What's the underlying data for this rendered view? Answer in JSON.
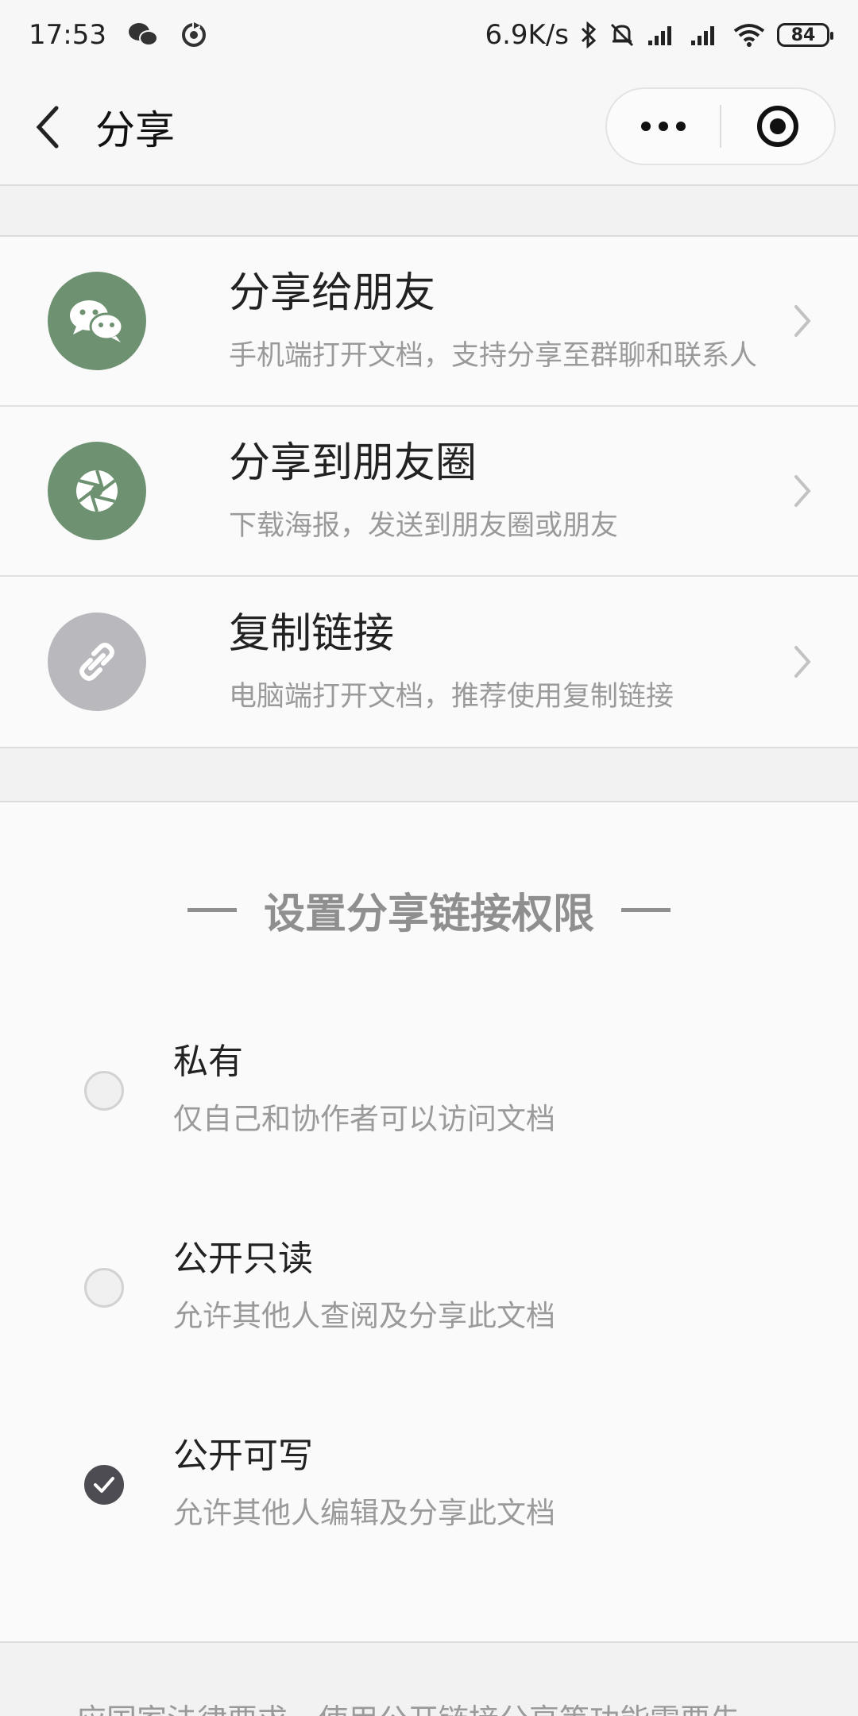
{
  "status_bar": {
    "time": "17:53",
    "net_speed": "6.9K/s",
    "battery": "84",
    "icons": [
      "wechat-icon",
      "sync-icon",
      "bluetooth-icon",
      "mute-icon",
      "signal-icon",
      "signal-icon",
      "wifi-icon"
    ]
  },
  "nav": {
    "title": "分享",
    "back_icon": "chevron-left-icon",
    "more_icon": "more-dots-icon",
    "close_icon": "target-icon"
  },
  "share_options": [
    {
      "title": "分享给朋友",
      "subtitle": "手机端打开文档，支持分享至群聊和联系人",
      "icon": "wechat-chat-icon",
      "color": "#6e9271"
    },
    {
      "title": "分享到朋友圈",
      "subtitle": "下载海报，发送到朋友圈或朋友",
      "icon": "moments-aperture-icon",
      "color": "#6e9271"
    },
    {
      "title": "复制链接",
      "subtitle": "电脑端打开文档，推荐使用复制链接",
      "icon": "link-icon",
      "color": "#b9b9bd"
    }
  ],
  "permissions": {
    "heading": "设置分享链接权限",
    "options": [
      {
        "title": "私有",
        "desc": "仅自己和协作者可以访问文档",
        "selected": false
      },
      {
        "title": "公开只读",
        "desc": "允许其他人查阅及分享此文档",
        "selected": false
      },
      {
        "title": "公开可写",
        "desc": "允许其他人编辑及分享此文档",
        "selected": true
      }
    ]
  },
  "footer_notice": "应国家法律要求，使用公开链接分享等功能需要先"
}
